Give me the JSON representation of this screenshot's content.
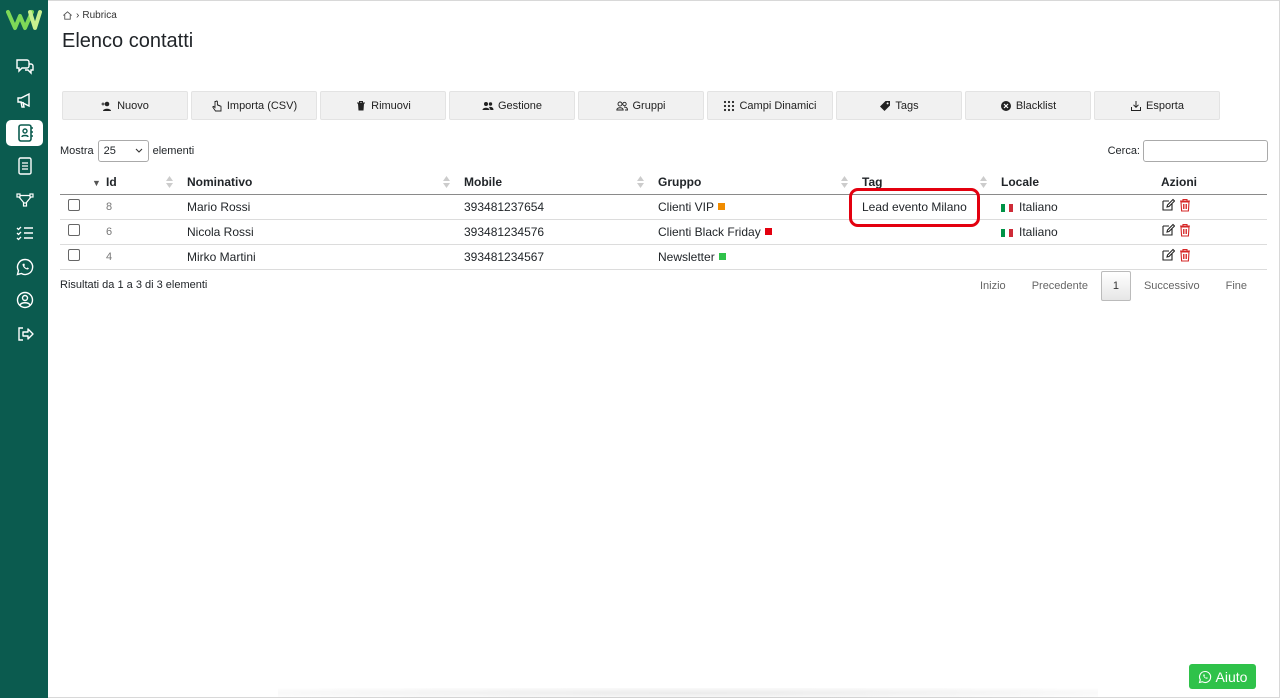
{
  "breadcrumb": {
    "current": "Rubrica"
  },
  "page": {
    "title": "Elenco contatti"
  },
  "toolbar": [
    {
      "label": "Nuovo",
      "icon": "user-plus-icon"
    },
    {
      "label": "Importa (CSV)",
      "icon": "hand-pointer-icon"
    },
    {
      "label": "Rimuovi",
      "icon": "trash-icon"
    },
    {
      "label": "Gestione",
      "icon": "users-icon"
    },
    {
      "label": "Gruppi",
      "icon": "users-outline-icon"
    },
    {
      "label": "Campi Dinamici",
      "icon": "grid-icon"
    },
    {
      "label": "Tags",
      "icon": "tag-icon"
    },
    {
      "label": "Blacklist",
      "icon": "times-circle-icon"
    },
    {
      "label": "Esporta",
      "icon": "download-icon"
    }
  ],
  "show": {
    "prefix": "Mostra",
    "value": "25",
    "suffix": "elementi"
  },
  "search": {
    "label": "Cerca:"
  },
  "table": {
    "headers": [
      "Id",
      "Nominativo",
      "Mobile",
      "Gruppo",
      "Tag",
      "Locale",
      "Azioni"
    ],
    "rows": [
      {
        "id": "8",
        "name": "Mario Rossi",
        "mobile": "393481237654",
        "group": "Clienti VIP",
        "group_color": "#f08c00",
        "tag": "Lead evento Milano",
        "locale": "Italiano"
      },
      {
        "id": "6",
        "name": "Nicola Rossi",
        "mobile": "393481234576",
        "group": "Clienti Black Friday",
        "group_color": "#e3000f",
        "tag": "",
        "locale": "Italiano"
      },
      {
        "id": "4",
        "name": "Mirko Martini",
        "mobile": "393481234567",
        "group": "Newsletter",
        "group_color": "#2fc24a",
        "tag": "",
        "locale": ""
      }
    ]
  },
  "info": "Risultati da 1 a 3 di 3 elementi",
  "pagination": {
    "first": "Inizio",
    "prev": "Precedente",
    "current": "1",
    "next": "Successivo",
    "last": "Fine"
  },
  "help": {
    "label": "Aiuto"
  },
  "colors": {
    "sidebar": "#0b5b4f",
    "accent": "#2fc24a",
    "highlight": "#e3000f"
  }
}
